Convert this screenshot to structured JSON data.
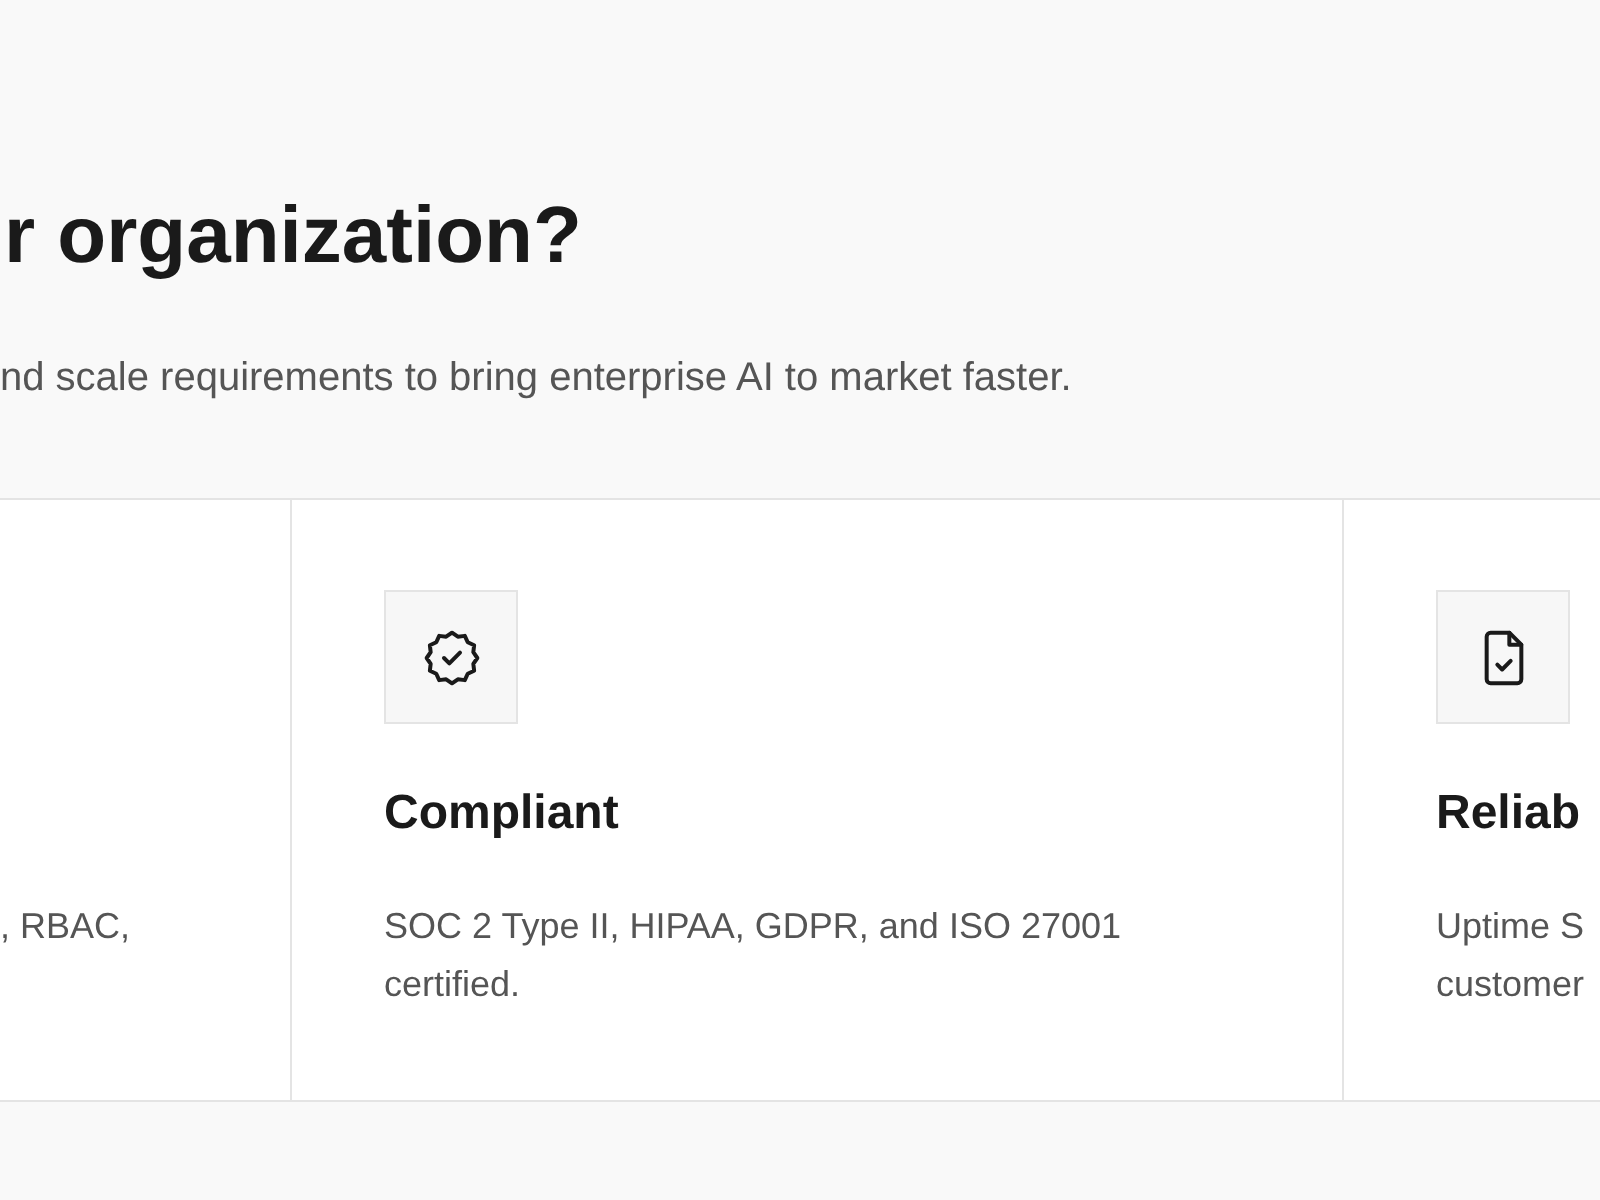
{
  "heading": "r organization?",
  "subtitle": "nd scale requirements to bring enterprise AI to market faster.",
  "cards": [
    {
      "description": ", RBAC,"
    },
    {
      "title": "Compliant",
      "description": "SOC 2 Type II, HIPAA, GDPR, and ISO 27001 certified."
    },
    {
      "title": "Reliab",
      "description_lines": [
        "Uptime S",
        "customer"
      ]
    }
  ]
}
